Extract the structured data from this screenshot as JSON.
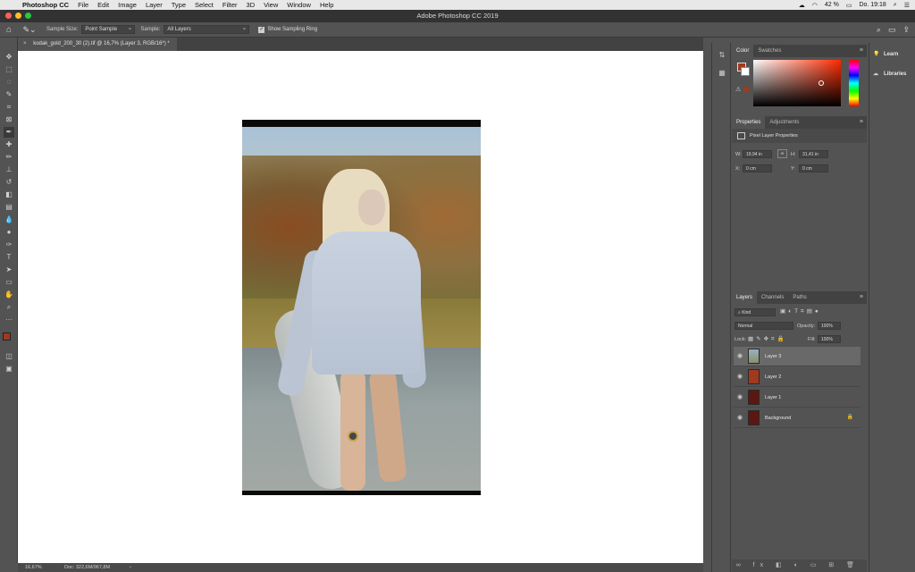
{
  "menubar": {
    "app": "Photoshop CC",
    "items": [
      "File",
      "Edit",
      "Image",
      "Layer",
      "Type",
      "Select",
      "Filter",
      "3D",
      "View",
      "Window",
      "Help"
    ],
    "battery": "42 %",
    "clock": "Do. 19:18"
  },
  "window": {
    "title": "Adobe Photoshop CC 2019"
  },
  "options": {
    "sample_size_label": "Sample Size:",
    "sample_size_value": "Point Sample",
    "sample_label": "Sample:",
    "sample_value": "All Layers",
    "show_ring_label": "Show Sampling Ring"
  },
  "document": {
    "tab_label": "kodak_gold_200_30 (2).tif @ 16,7% (Layer 3, RGB/16*) *"
  },
  "status": {
    "zoom": "16,67%",
    "doc": "Doc: 322,6M/967,8M"
  },
  "color_panel": {
    "tabs": [
      "Color",
      "Swatches"
    ],
    "foreground": "#a0391e",
    "background": "#ffffff"
  },
  "properties_panel": {
    "tabs": [
      "Properties",
      "Adjustments"
    ],
    "header": "Pixel Layer Properties",
    "w_label": "W:",
    "w_value": "19,94 in",
    "h_label": "H:",
    "h_value": "31,41 in",
    "x_label": "X:",
    "x_value": "0 cm",
    "y_label": "Y:",
    "y_value": "0 cm"
  },
  "layers_panel": {
    "tabs": [
      "Layers",
      "Channels",
      "Paths"
    ],
    "kind_label": "Kind",
    "blend_mode": "Normal",
    "opacity_label": "Opacity:",
    "opacity_value": "100%",
    "lock_label": "Lock:",
    "fill_label": "Fill:",
    "fill_value": "100%",
    "layers": [
      {
        "name": "Layer 3",
        "thumb": "#8aa0b0",
        "selected": true
      },
      {
        "name": "Layer 2",
        "thumb": "#a0391e",
        "selected": false
      },
      {
        "name": "Layer 1",
        "thumb": "#5a1810",
        "selected": false
      },
      {
        "name": "Background",
        "thumb": "#5a1810",
        "selected": false
      }
    ]
  },
  "right_panel": {
    "learn": "Learn",
    "libraries": "Libraries"
  }
}
